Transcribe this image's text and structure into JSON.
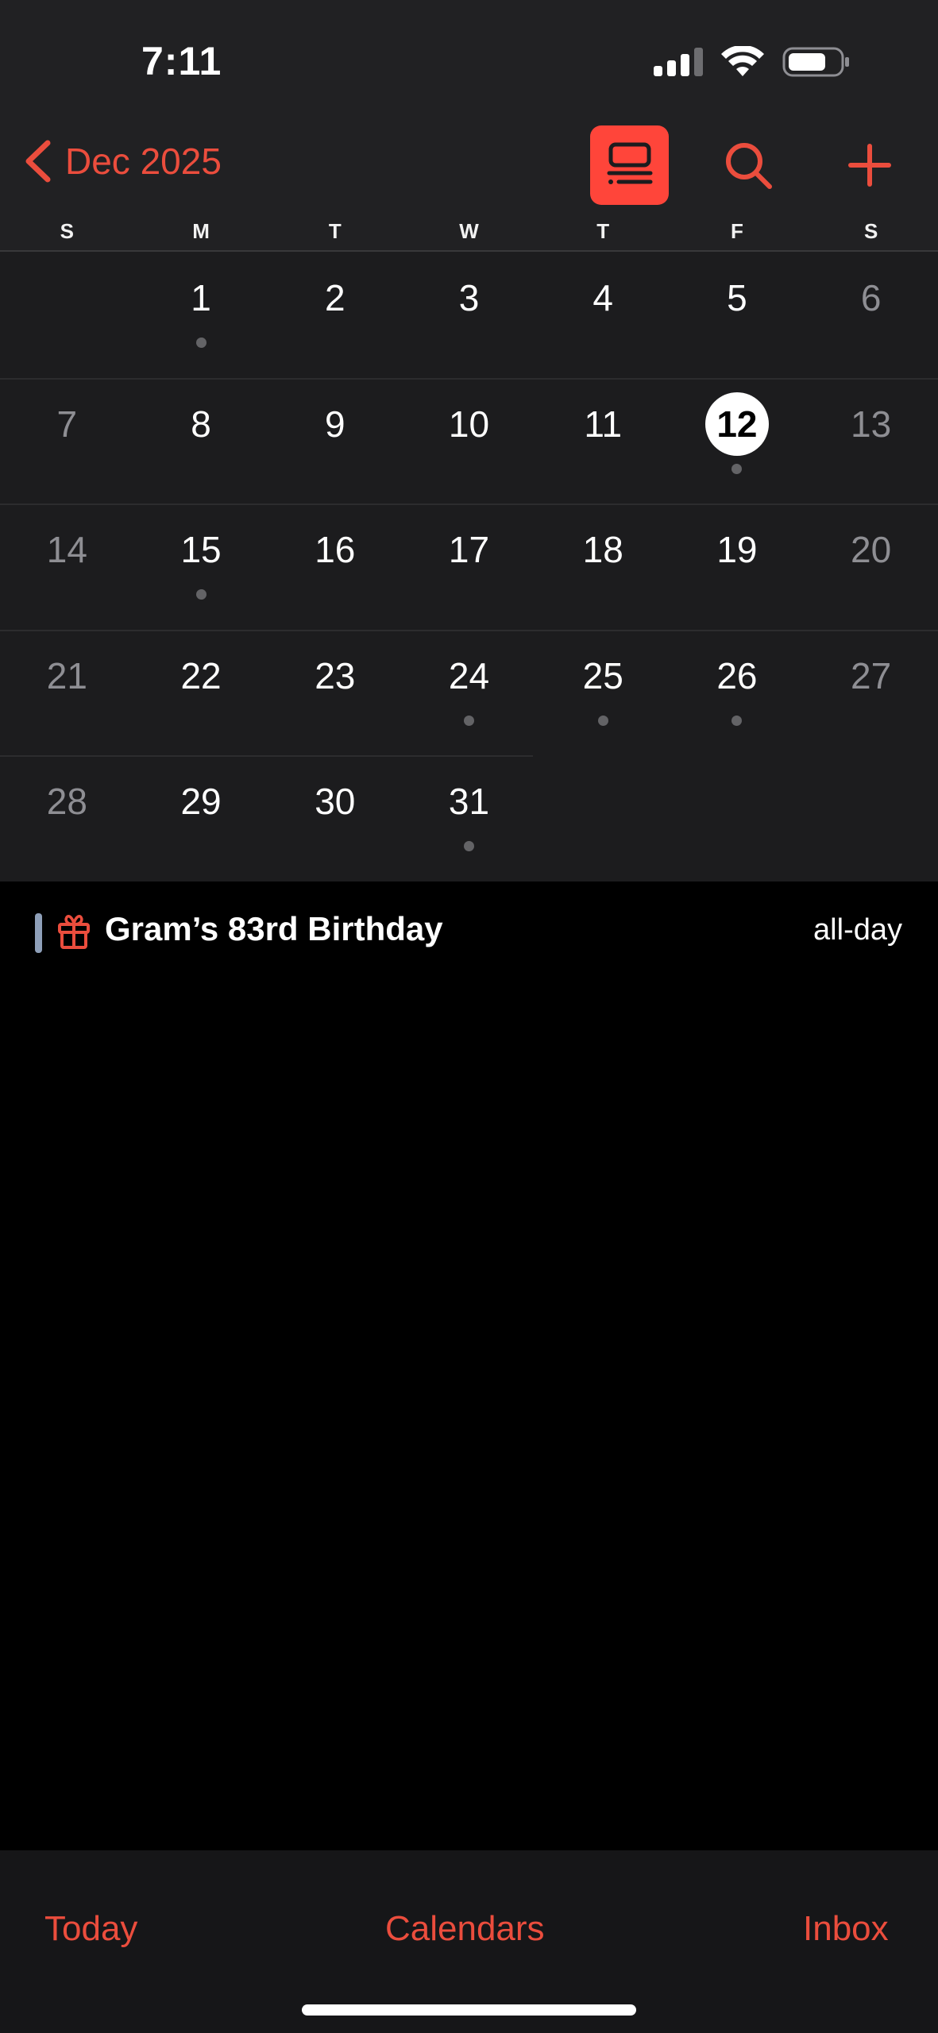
{
  "status_bar": {
    "time": "7:11"
  },
  "nav": {
    "back_label": "Dec 2025",
    "back_icon": "chevron-left-icon",
    "list_view_icon": "list-view-icon",
    "search_icon": "search-icon",
    "add_icon": "plus-icon"
  },
  "weekdays": [
    "S",
    "M",
    "T",
    "W",
    "T",
    "F",
    "S"
  ],
  "calendar": {
    "weeks": [
      [
        null,
        {
          "day": "1",
          "dot": true
        },
        {
          "day": "2"
        },
        {
          "day": "3"
        },
        {
          "day": "4"
        },
        {
          "day": "5"
        },
        {
          "day": "6"
        }
      ],
      [
        {
          "day": "7"
        },
        {
          "day": "8"
        },
        {
          "day": "9"
        },
        {
          "day": "10"
        },
        {
          "day": "11"
        },
        {
          "day": "12",
          "today": true,
          "dot": true
        },
        {
          "day": "13"
        }
      ],
      [
        {
          "day": "14"
        },
        {
          "day": "15",
          "dot": true
        },
        {
          "day": "16"
        },
        {
          "day": "17"
        },
        {
          "day": "18"
        },
        {
          "day": "19"
        },
        {
          "day": "20"
        }
      ],
      [
        {
          "day": "21"
        },
        {
          "day": "22"
        },
        {
          "day": "23"
        },
        {
          "day": "24",
          "dot": true
        },
        {
          "day": "25",
          "dot": true
        },
        {
          "day": "26",
          "dot": true
        },
        {
          "day": "27"
        }
      ],
      [
        {
          "day": "28"
        },
        {
          "day": "29"
        },
        {
          "day": "30"
        },
        {
          "day": "31",
          "dot": true
        },
        null,
        null,
        null
      ]
    ]
  },
  "events": [
    {
      "title": "Gram’s 83rd Birthday",
      "time": "all-day",
      "icon": "gift-icon",
      "calendar_color": "#8e9fb8"
    }
  ],
  "toolbar": {
    "today_label": "Today",
    "calendars_label": "Calendars",
    "inbox_label": "Inbox"
  },
  "colors": {
    "accent": "#eb4d3d",
    "accent_fill": "#ff453a"
  }
}
